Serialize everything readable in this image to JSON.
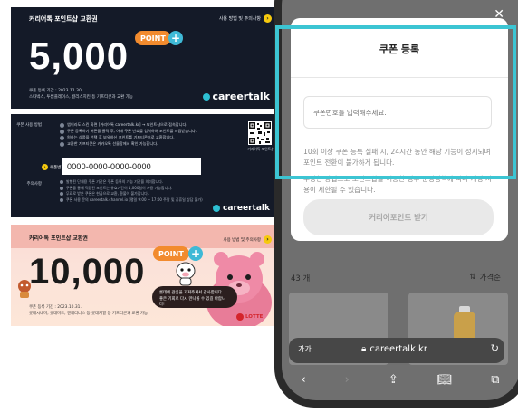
{
  "coupon_card": {
    "title": "커리어톡 포인트샵 교환권",
    "link_label": "사용 방법 및 주의사항",
    "amount": "5,000",
    "point_badge": "POINT",
    "meta_line1": "쿠폰 등록 기간 : 2023.11.30",
    "meta_line2": "스타벅스, 투썸플레이스, 컬리스치킨 등 기프티콘과 교환 가능",
    "brand": "careertalk"
  },
  "usage_card": {
    "section_label": "쿠폰 사용 방법",
    "steps": [
      "앱이라도 스킨 화면 [커리어톡 careertalk.kr] → 포인트샵으로 접속합니다.",
      "쿠폰 등록하기 버튼을 클릭 후, 아래 쿠폰 번호를 입력하여 포인트를 지급받습니다.",
      "원하는 상품을 선택 후 보유하신 포인트를 기프티콘으로 교환합니다.",
      "교환한 기프티콘은 카카오톡 선물함에서 확인 가능합니다."
    ],
    "qr_caption": "커리어톡 포인트샵",
    "code_label": "쿠폰번호",
    "code": "0000-0000-0000-0000",
    "notes_label": "주의사항",
    "notes": [
      "발행된 단체용 쿠폰 기간은 쿠폰 등록의 가능 기간을 의미합니다.",
      "쿠폰을 통해 적립된 포인트는 유효기간이 1,000일이 사용 가능합니다.",
      "무료로 받은 쿠폰은 현금으로 교환, 환불이 불가합니다.",
      "쿠폰 사용 문의 careertalk.channel.io (평일 9:00 ~ 17:00 주말 및 공휴일 상담 불가)"
    ],
    "brand": "careertalk"
  },
  "lotte_card": {
    "title": "커리어톡 포인트샵 교환권",
    "link_label": "사용 방법 및 주의사항",
    "amount": "10,000",
    "point_badge": "POINT",
    "bubble_line1": "롯데에 관심을 가져주셔서 감사합니다.",
    "bubble_line2": "좋은 기회로 다시 만나볼 수 있길 바랍니다!",
    "meta_line1": "쿠폰 등록 기간 : 2023.10.31.",
    "meta_line2": "롯데시네마, 롯데마트, 엔제리너스 등 롯데계열 등 기프티콘과 교환 가능",
    "brand": "LOTTE"
  },
  "phone": {
    "close_icon": "✕",
    "sheet_title": "쿠폰 등록",
    "input_placeholder": "쿠폰번호를 입력해주세요.",
    "warning_text": "10회 이상 쿠폰 등록 실패 시, 24시간 동안 해당 기능이 정지되며 포인트 전환이 불가하게 됩니다.",
    "policy_text": "부당한 방법으로 포인트샵을 이용한 경우 운영정책에 따라 계정 사용이 제한될 수 있습니다.",
    "submit_label": "커리어포인트 받기",
    "list_count": "43 개",
    "sort_label": "가격순",
    "url_aa": "가가",
    "url": "careertalk.kr"
  },
  "colors": {
    "highlight": "#3cc5d3",
    "point_orange": "#f28b2e",
    "dark_card": "#141a28"
  }
}
